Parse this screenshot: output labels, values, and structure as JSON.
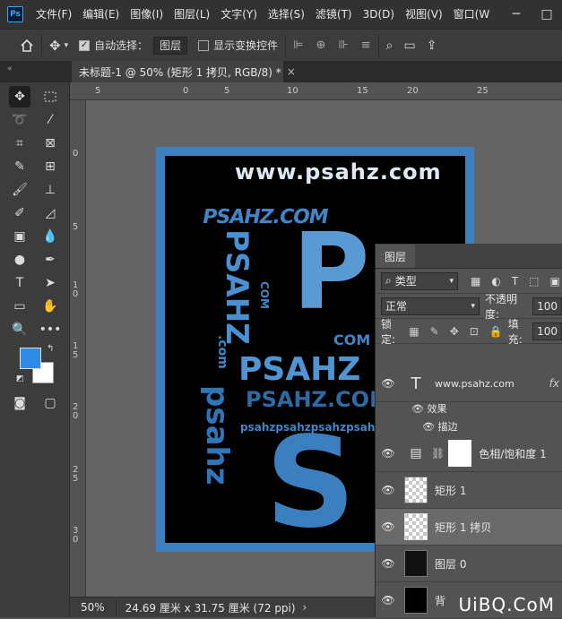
{
  "app": {
    "logo": "Ps",
    "menu": [
      "文件(F)",
      "编辑(E)",
      "图像(I)",
      "图层(L)",
      "文字(Y)",
      "选择(S)",
      "滤镜(T)",
      "3D(D)",
      "视图(V)",
      "窗口(W"
    ],
    "window_controls": [
      "─",
      "□"
    ]
  },
  "options": {
    "auto_select_label": "自动选择：",
    "auto_select_value": "图层",
    "show_transform_label": "显示变换控件"
  },
  "document": {
    "tab_title": "未标题-1 @ 50% (矩形 1 拷贝, RGB/8) *",
    "close": "×",
    "collapse": "«",
    "zoom": "50%",
    "doc_info": "24.69 厘米 x 31.75 厘米 (72 ppi)",
    "status_arrow": "›"
  },
  "rulers": {
    "top": [
      "5",
      "0",
      "5",
      "10",
      "15",
      "20",
      "25"
    ],
    "left": [
      "0",
      "5",
      "1 0",
      "1 5",
      "2 0",
      "2 5",
      "3 0"
    ]
  },
  "artwork": {
    "url": "www.psahz.com",
    "brand": "PSAHZ",
    "brand_com": "PSAHZ.COM",
    "letter_p": "P",
    "letter_s": "S",
    "com": "COM",
    "vertical_word": "psahz",
    "repeat": "psahzpsahzpsahzpsahz",
    "vertical_upper": "PSAHZ",
    "vertical_com": "COM",
    "dot_com": ".com"
  },
  "layers_panel": {
    "tab": "图层",
    "filter_label": "类型",
    "blend_mode": "正常",
    "opacity_label": "不透明度:",
    "opacity_value": "100",
    "lock_label": "锁定:",
    "fill_label": "填充:",
    "fill_value": "100",
    "fx_label": "fx",
    "effects_label": "效果",
    "stroke_label": "描边",
    "chain": "⛓",
    "layers": [
      {
        "name": "www.psahz.com",
        "type": "text"
      },
      {
        "name": "色相/饱和度 1",
        "type": "adjustment"
      },
      {
        "name": "矩形 1",
        "type": "shape"
      },
      {
        "name": "矩形 1 拷贝",
        "type": "shape",
        "selected": true
      },
      {
        "name": "图层 0",
        "type": "pixel"
      },
      {
        "name": "背",
        "type": "background"
      }
    ]
  },
  "watermark": "UiBQ.CoM",
  "colors": {
    "foreground": "#2f8ce6",
    "background": "#ffffff",
    "frame_blue": "#3d80c0"
  }
}
